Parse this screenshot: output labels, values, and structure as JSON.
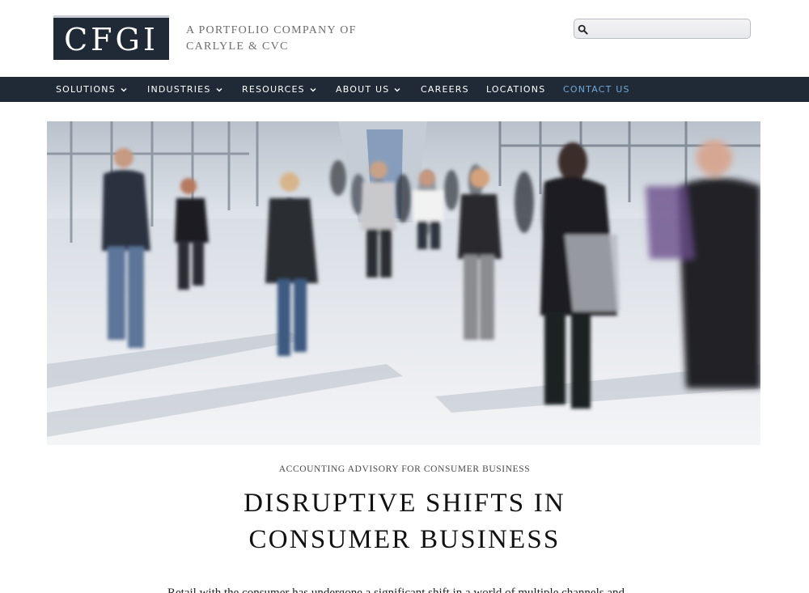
{
  "header": {
    "logo_text": "CFGI",
    "tagline_line1": "A PORTFOLIO COMPANY OF",
    "tagline_line2": "CARLYLE & CVC",
    "search_placeholder": "",
    "search_icon": "search-icon"
  },
  "nav": {
    "items": [
      {
        "label": "SOLUTIONS",
        "has_dropdown": true
      },
      {
        "label": "INDUSTRIES",
        "has_dropdown": true
      },
      {
        "label": "RESOURCES",
        "has_dropdown": true
      },
      {
        "label": "ABOUT US",
        "has_dropdown": true
      },
      {
        "label": "CAREERS",
        "has_dropdown": false
      },
      {
        "label": "LOCATIONS",
        "has_dropdown": false
      },
      {
        "label": "CONTACT US",
        "has_dropdown": false,
        "active": true
      }
    ]
  },
  "main": {
    "eyebrow": "ACCOUNTING ADVISORY FOR CONSUMER BUSINESS",
    "headline_line1": "DISRUPTIVE SHIFTS IN",
    "headline_line2": "CONSUMER BUSINESS",
    "body_partial": "Retail with the consumer has undergone a significant shift in a world of multiple channels and"
  },
  "colors": {
    "brand_navy": "#1f2a36",
    "accent_blue": "#74a7d6",
    "tagline_gray": "#6d6d6d"
  }
}
